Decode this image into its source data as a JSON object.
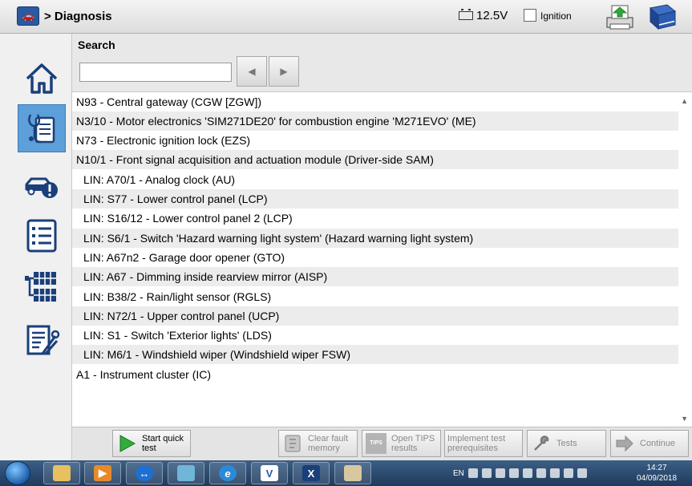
{
  "header": {
    "breadcrumb": "> Diagnosis",
    "voltage": "12.5V",
    "ignition_label": "Ignition"
  },
  "sidebar": {
    "items": [
      {
        "icon": "home-icon"
      },
      {
        "icon": "diagnosis-clipboard-icon",
        "active": true
      },
      {
        "icon": "car-warning-icon"
      },
      {
        "icon": "list-icon"
      },
      {
        "icon": "control-units-icon"
      },
      {
        "icon": "document-tools-icon"
      }
    ]
  },
  "search": {
    "label": "Search",
    "value": "",
    "placeholder": ""
  },
  "modules": [
    {
      "text": "N93 - Central gateway (CGW [ZGW])",
      "indent": false
    },
    {
      "text": "N3/10 - Motor electronics 'SIM271DE20' for combustion engine 'M271EVO' (ME)",
      "indent": false
    },
    {
      "text": "N73 - Electronic ignition lock (EZS)",
      "indent": false
    },
    {
      "text": "N10/1 - Front signal acquisition and actuation module (Driver-side SAM)",
      "indent": false
    },
    {
      "text": "LIN: A70/1 - Analog clock (AU)",
      "indent": true
    },
    {
      "text": "LIN: S77 - Lower control panel (LCP)",
      "indent": true
    },
    {
      "text": "LIN: S16/12 - Lower control panel 2 (LCP)",
      "indent": true
    },
    {
      "text": "LIN: S6/1 - Switch 'Hazard warning light system' (Hazard warning light system)",
      "indent": true
    },
    {
      "text": "LIN: A67n2 - Garage door opener (GTO)",
      "indent": true
    },
    {
      "text": "LIN: A67 - Dimming inside rearview mirror (AISP)",
      "indent": true
    },
    {
      "text": "LIN: B38/2 - Rain/light sensor (RGLS)",
      "indent": true
    },
    {
      "text": "LIN: N72/1 - Upper control panel (UCP)",
      "indent": true
    },
    {
      "text": "LIN: S1 - Switch 'Exterior lights' (LDS)",
      "indent": true
    },
    {
      "text": "LIN: M6/1 - Windshield wiper (Windshield wiper FSW)",
      "indent": true
    },
    {
      "text": "A1 - Instrument cluster (IC)",
      "indent": false
    }
  ],
  "actions": {
    "quick_test": {
      "line1": "Start quick",
      "line2": "test"
    },
    "clear_fault": {
      "line1": "Clear fault",
      "line2": "memory"
    },
    "open_tips": {
      "line1": "Open TIPS",
      "line2": "results",
      "icon_text": "TIPS"
    },
    "implement_test": {
      "line1": "Implement test",
      "line2": "prerequisites"
    },
    "tests": {
      "label": "Tests"
    },
    "continue": {
      "label": "Continue"
    }
  },
  "taskbar": {
    "language": "EN",
    "time": "14:27",
    "date": "04/09/2018"
  },
  "colors": {
    "active_sidebar": "#5d9fd8",
    "accent_blue": "#1f5fa8",
    "row_alt": "#ececec"
  }
}
